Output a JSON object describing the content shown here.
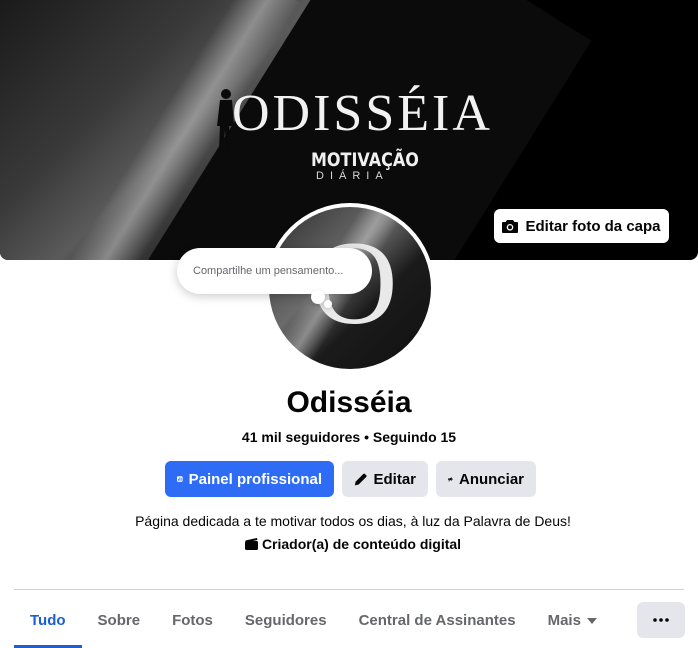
{
  "cover": {
    "title": "ODISSÉIA",
    "subtitle_line1": "MOTIVAÇÃO",
    "subtitle_line2": "DIÁRIA",
    "edit_button_label": "Editar foto da capa",
    "edit_button_icon": "camera-icon"
  },
  "avatar": {
    "letter": "O"
  },
  "thought_bubble": {
    "placeholder": "Compartilhe um pensamento..."
  },
  "profile": {
    "name": "Odisséia",
    "stats": "41 mil seguidores • Seguindo 15",
    "bio": "Página dedicada a te motivar todos os dias, à luz da Palavra de Deus!",
    "category": "Criador(a) de conteúdo digital",
    "category_icon": "clapperboard-icon"
  },
  "actions": {
    "dashboard_label": "Painel profissional",
    "dashboard_icon": "bar-chart-icon",
    "edit_label": "Editar",
    "edit_icon": "pencil-icon",
    "advertise_label": "Anunciar",
    "advertise_icon": "megaphone-icon"
  },
  "tabs": [
    {
      "label": "Tudo",
      "active": true
    },
    {
      "label": "Sobre",
      "active": false
    },
    {
      "label": "Fotos",
      "active": false
    },
    {
      "label": "Seguidores",
      "active": false
    },
    {
      "label": "Central de Assinantes",
      "active": false
    },
    {
      "label": "Mais",
      "active": false
    }
  ],
  "more_menu_icon": "ellipsis-icon",
  "colors": {
    "primary": "#2f6cf5",
    "active_tab": "#1b5fd1",
    "secondary_button": "#e4e6eb",
    "muted_text": "#65676b"
  }
}
